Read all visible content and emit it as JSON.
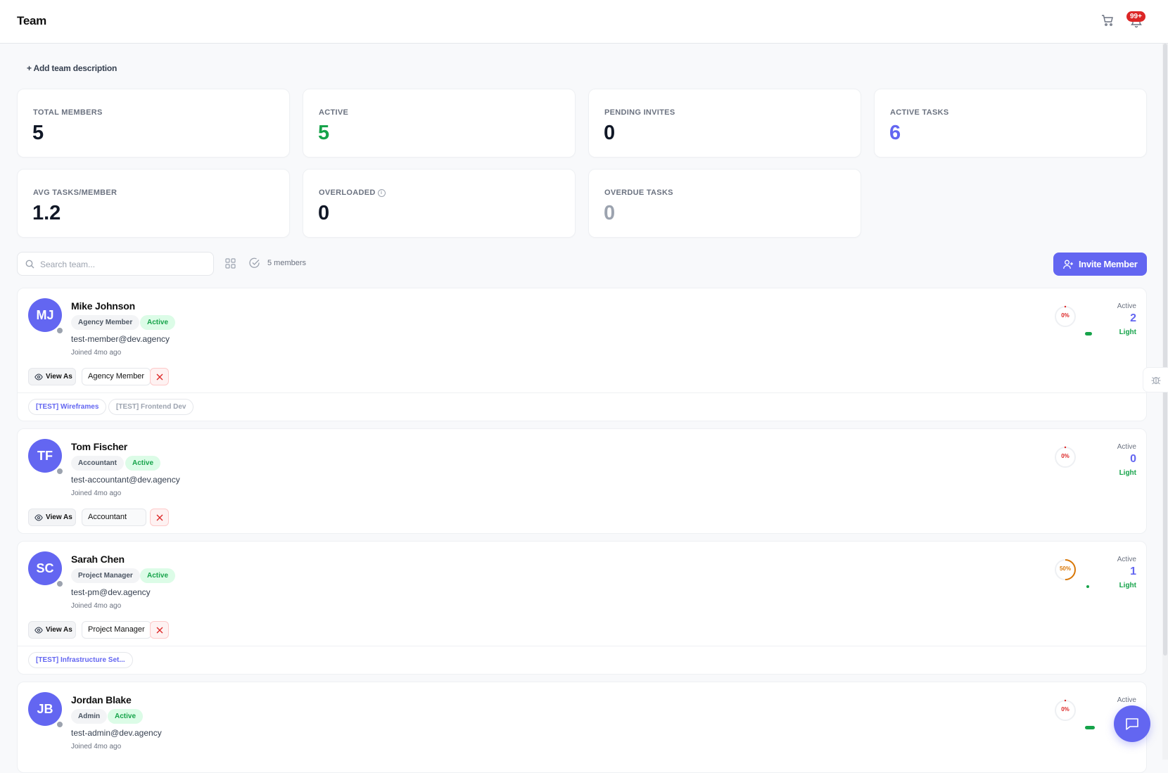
{
  "header": {
    "title": "Team",
    "notification_badge": "99+"
  },
  "add_description_label": "+ Add team description",
  "stats": [
    {
      "label": "TOTAL MEMBERS",
      "value": "5",
      "color": "#111827"
    },
    {
      "label": "ACTIVE",
      "value": "5",
      "color": "#16a34a"
    },
    {
      "label": "PENDING INVITES",
      "value": "0",
      "color": "#111827"
    },
    {
      "label": "ACTIVE TASKS",
      "value": "6",
      "color": "#6366f1"
    },
    {
      "label": "AVG TASKS/MEMBER",
      "value": "1.2",
      "color": "#111827"
    },
    {
      "label": "OVERLOADED",
      "value": "0",
      "color": "#111827"
    },
    {
      "label": "OVERDUE TASKS",
      "value": "0",
      "color": "#9ca3af"
    }
  ],
  "toolbar": {
    "search_placeholder": "Search team...",
    "members_count": "5 members",
    "invite_label": "Invite Member"
  },
  "members": [
    {
      "initials": "MJ",
      "name": "Mike Johnson",
      "role": "Agency Member",
      "status": "Active",
      "email": "test-member@dev.agency",
      "joined": "Joined 4mo ago",
      "view_as": "View As",
      "role_select": "Agency Member",
      "utilization": "0%",
      "utilization_value": 0,
      "active_label": "Active",
      "active_count": "2",
      "load": "Light",
      "projects": [
        "[TEST] Wireframes",
        "[TEST] Frontend Dev"
      ]
    },
    {
      "initials": "TF",
      "name": "Tom Fischer",
      "role": "Accountant",
      "status": "Active",
      "email": "test-accountant@dev.agency",
      "joined": "Joined 4mo ago",
      "view_as": "View As",
      "role_select": "Accountant",
      "utilization": "0%",
      "utilization_value": 0,
      "active_label": "Active",
      "active_count": "0",
      "load": "Light",
      "projects": []
    },
    {
      "initials": "SC",
      "name": "Sarah Chen",
      "role": "Project Manager",
      "status": "Active",
      "email": "test-pm@dev.agency",
      "joined": "Joined 4mo ago",
      "view_as": "View As",
      "role_select": "Project Manager",
      "utilization": "50%",
      "utilization_value": 50,
      "active_label": "Active",
      "active_count": "1",
      "load": "Light",
      "projects": [
        "[TEST] Infrastructure Set..."
      ]
    },
    {
      "initials": "JB",
      "name": "Jordan Blake",
      "role": "Admin",
      "status": "Active",
      "email": "test-admin@dev.agency",
      "joined": "Joined 4mo ago",
      "utilization": "0%",
      "utilization_value": 0,
      "active_label": "Active"
    }
  ],
  "icons": {
    "cart": "cart-icon",
    "bell": "bell-icon",
    "search": "search-icon",
    "grid": "grid-icon",
    "check": "check-circle-icon",
    "invite": "user-plus-icon",
    "eye": "eye-icon",
    "remove": "close-icon",
    "chat": "chat-icon",
    "bug": "bug-icon",
    "info": "info-icon"
  },
  "colors": {
    "accent": "#6366f1",
    "success": "#16a34a",
    "danger": "#dc2626",
    "warning": "#d97706"
  }
}
